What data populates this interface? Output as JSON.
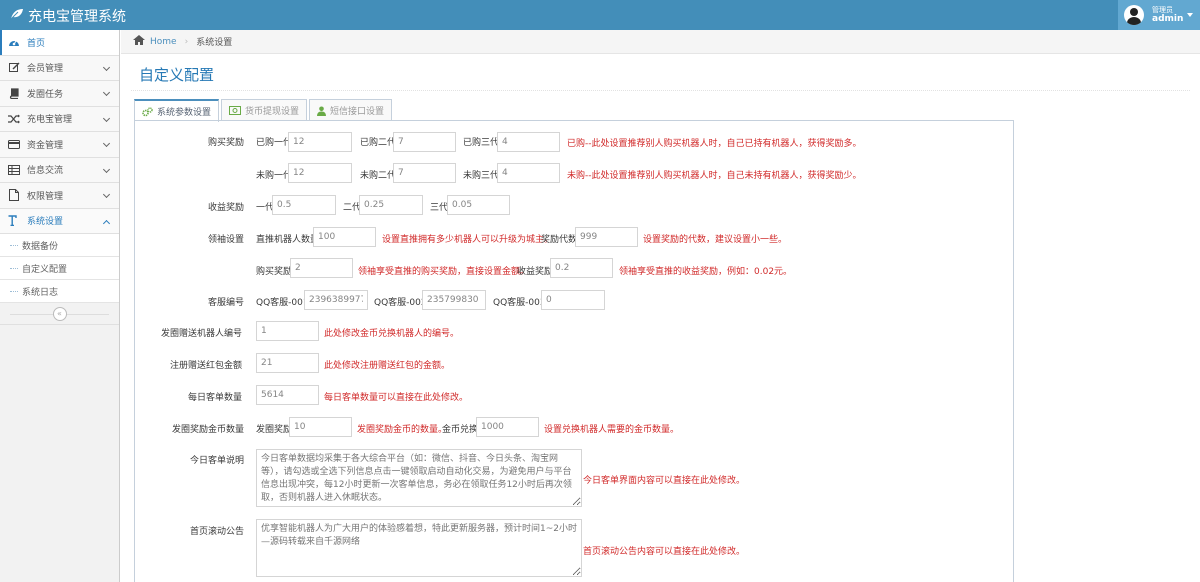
{
  "app": {
    "title": "充电宝管理系统"
  },
  "user": {
    "role": "管理员",
    "name": "admin"
  },
  "sidebar": {
    "items": [
      {
        "label": "首页",
        "icon": "dashboard-icon"
      },
      {
        "label": "会员管理",
        "icon": "edit-icon"
      },
      {
        "label": "发圈任务",
        "icon": "book-icon"
      },
      {
        "label": "充电宝管理",
        "icon": "shuffle-icon"
      },
      {
        "label": "资金管理",
        "icon": "credit-card-icon"
      },
      {
        "label": "信息交流",
        "icon": "list-icon"
      },
      {
        "label": "权限管理",
        "icon": "file-icon"
      },
      {
        "label": "系统设置",
        "icon": "text-height-icon"
      }
    ],
    "subitems": [
      "数据备份",
      "自定义配置",
      "系统日志"
    ],
    "collapse_glyph": "«"
  },
  "breadcrumb": {
    "home": "Home",
    "current": "系统设置"
  },
  "page": {
    "title": "自定义配置"
  },
  "tabs": [
    {
      "label": "系统参数设置",
      "icon": "cogs-icon"
    },
    {
      "label": "货币提现设置",
      "icon": "money-icon"
    },
    {
      "label": "短信接口设置",
      "icon": "user-icon"
    }
  ],
  "form": {
    "buy_reward": {
      "label": "购买奖励",
      "bought": {
        "gen1_label": "已购一代",
        "gen1": "12",
        "gen2_label": "已购二代",
        "gen2": "7",
        "gen3_label": "已购三代",
        "gen3": "4",
        "hint": "已购--此处设置推荐别人购买机器人时，自己已持有机器人，获得奖励多。"
      },
      "unbought": {
        "gen1_label": "未购一代",
        "gen1": "12",
        "gen2_label": "未购二代",
        "gen2": "7",
        "gen3_label": "未购三代",
        "gen3": "4",
        "hint": "未购--此处设置推荐别人购买机器人时，自己未持有机器人，获得奖励少。"
      }
    },
    "income_reward": {
      "label": "收益奖励",
      "gen1_label": "一代",
      "gen1": "0.5",
      "gen2_label": "二代",
      "gen2": "0.25",
      "gen3_label": "三代",
      "gen3": "0.05"
    },
    "leader": {
      "label": "领袖设置",
      "robots_label": "直推机器人数量",
      "robots": "100",
      "robots_hint": "设置直推拥有多少机器人可以升级为城主。",
      "generations_label": "奖励代数",
      "generations": "999",
      "generations_hint": "设置奖励的代数，建议设置小一些。",
      "buy_label": "购买奖励",
      "buy": "2",
      "buy_hint": "领袖享受直推的购买奖励，直接设置金额。",
      "income_label": "收益奖励",
      "income": "0.2",
      "income_hint": "领袖享受直推的收益奖励，例如：0.02元。"
    },
    "service": {
      "label": "客服编号",
      "qq1_label": "QQ客服-001",
      "qq1": "2396389977",
      "qq2_label": "QQ客服-002",
      "qq2": "235799830",
      "qq3_label": "QQ客服-003",
      "qq3": "0"
    },
    "robot_id": {
      "label": "发圈赠送机器人编号",
      "value": "1",
      "hint": "此处修改金币兑换机器人的编号。"
    },
    "red_packet": {
      "label": "注册赠送红包金额",
      "value": "21",
      "hint": "此处修改注册赠送红包的金额。"
    },
    "daily_orders": {
      "label": "每日客单数量",
      "value": "5614",
      "hint": "每日客单数量可以直接在此处修改。"
    },
    "coin_reward": {
      "label": "发圈奖励金币数量",
      "circle_label": "发圈奖励",
      "circle": "10",
      "circle_hint": "发圈奖励金币的数量。",
      "exchange_label": "金币兑换",
      "exchange": "1000",
      "exchange_hint": "设置兑换机器人需要的金币数量。"
    },
    "daily_desc": {
      "label": "今日客单说明",
      "placeholder": "今日客单数据均采集于各大综合平台（如：微信、抖音、今日头条、淘宝网等），请勾选或全选下列信息点击一键领取启动自动化交易，为避免用户与平台信息出现冲突，每12小时更新一次客单信息，务必在领取任务12小时后再次领取，否则机器人进入休眠状态。",
      "hint": "今日客单界面内容可以直接在此处修改。"
    },
    "notice": {
      "label": "首页滚动公告",
      "placeholder": "优享智能机器人为广大用户的体验感着想，特此更新服务器，预计时间1~2小时—源码转载来自千源网络",
      "hint": "首页滚动公告内容可以直接在此处修改。"
    }
  }
}
